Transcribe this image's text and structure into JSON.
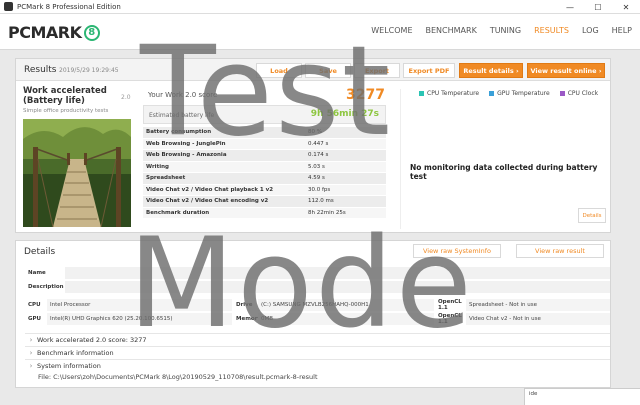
{
  "window": {
    "title": "PCMark 8 Professional Edition",
    "controls": [
      "—",
      "☐",
      "✕"
    ]
  },
  "app": {
    "logo_text": "PCMARK",
    "logo_mark": "8"
  },
  "nav": {
    "items": [
      "WELCOME",
      "BENCHMARK",
      "TUNING",
      "RESULTS",
      "LOG",
      "HELP"
    ],
    "active": "RESULTS"
  },
  "results": {
    "title": "Results",
    "date": "2019/5/29 19:29:45",
    "buttons": {
      "load": "Load",
      "save": "Save",
      "export": "Export",
      "export_pdf": "Export PDF",
      "result_details": "Result details ›",
      "view_online": "View result online ›"
    },
    "test": {
      "name": "Work accelerated (Battery life)",
      "version": "2.0",
      "subtitle": "Simple office productivity tests"
    },
    "score_label": "Your Work 2.0 score",
    "score_value": "3277",
    "battery_label": "Estimated battery life",
    "battery_value": "9h 56min 27s",
    "metrics": [
      {
        "k": "Battery consumption",
        "v": "80 %"
      },
      {
        "k": "Web Browsing - JunglePin",
        "v": "0.447 s"
      },
      {
        "k": "Web Browsing - Amazonia",
        "v": "0.174 s"
      },
      {
        "k": "Writing",
        "v": "5.03 s"
      },
      {
        "k": "Spreadsheet",
        "v": "4.59 s"
      },
      {
        "k": "Video Chat v2 / Video Chat playback 1 v2",
        "v": "30.0 fps"
      },
      {
        "k": "Video Chat v2 / Video Chat encoding v2",
        "v": "112.0 ms"
      },
      {
        "k": "Benchmark duration",
        "v": "8h 22min 25s"
      }
    ],
    "legend": [
      {
        "label": "CPU Temperature",
        "color": "#2bc4b4"
      },
      {
        "label": "GPU Temperature",
        "color": "#3aa0d8"
      },
      {
        "label": "CPU Clock",
        "color": "#9b59c6"
      }
    ],
    "no_data_text": "No monitoring data collected during battery test",
    "details_button": "Details"
  },
  "details": {
    "title": "Details",
    "view_sysinfo": "View raw SystemInfo",
    "view_result": "View raw result",
    "name_label": "Name",
    "description_label": "Description",
    "spec": [
      {
        "k1": "CPU",
        "v1": "Intel Processor",
        "k2": "Drive",
        "v2": "(C:) SAMSUNG MZVLB256HAHQ-000H1",
        "k3": "OpenCL 1.1",
        "v3": "Spreadsheet - Not in use"
      },
      {
        "k1": "GPU",
        "v1": "Intel(R) UHD Graphics 620 (25.20.100.6515)",
        "k2": "Memory",
        "v2": "0MB",
        "k3": "OpenCL 1.1",
        "v3": "Video Chat v2 - Not in use"
      }
    ],
    "expanders": [
      "Work accelerated 2.0 score: 3277",
      "Benchmark information",
      "System information"
    ],
    "file_path": "File: C:\\Users\\zoh\\Documents\\PCMark 8\\Log\\20190529_110708\\result.pcmark-8-result"
  },
  "bottom_tab": "ide",
  "watermark": {
    "line1": "Test",
    "line2": "Mode"
  }
}
